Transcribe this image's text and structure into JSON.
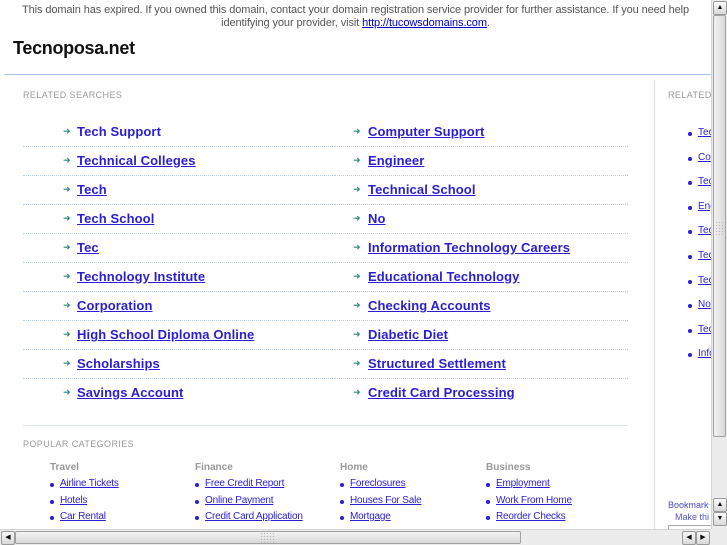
{
  "notice": {
    "text_before": "This domain has expired. If you owned this domain, contact your domain registration service provider for further assistance. If you need help identifying your provider, visit ",
    "link": "http://tucowsdomains.com",
    "text_after": "."
  },
  "site_title": "Tecnoposa.net",
  "related_searches": {
    "label": "RELATED SEARCHES",
    "left": [
      "Tech Support",
      "Technical Colleges",
      "Tech",
      "Tech School",
      "Tec",
      "Technology Institute",
      "Corporation",
      "High School Diploma Online",
      "Scholarships",
      "Savings Account"
    ],
    "right": [
      "Computer Support",
      "Engineer",
      "Technical School",
      "No",
      "Information Technology Careers",
      "Educational Technology",
      "Checking Accounts",
      "Diabetic Diet",
      "Structured Settlement",
      "Credit Card Processing"
    ]
  },
  "popular_categories": {
    "label": "POPULAR CATEGORIES",
    "categories": [
      {
        "title": "Travel",
        "links": [
          "Airline Tickets",
          "Hotels",
          "Car Rental"
        ]
      },
      {
        "title": "Finance",
        "links": [
          "Free Credit Report",
          "Online Payment",
          "Credit Card Application"
        ]
      },
      {
        "title": "Home",
        "links": [
          "Foreclosures",
          "Houses For Sale",
          "Mortgage"
        ]
      },
      {
        "title": "Business",
        "links": [
          "Employment",
          "Work From Home",
          "Reorder Checks"
        ]
      }
    ]
  },
  "sidebar": {
    "label": "RELATED",
    "items": [
      "Tec",
      "Co",
      "Tec",
      "Eng",
      "Tec",
      "Tec",
      "Tec",
      "No",
      "Tec",
      "Info"
    ],
    "bookmark": "Bookmark",
    "make_this": "Make thi"
  },
  "colors": {
    "link": "#2a1ed4",
    "arrow": "#2e8a7e",
    "rule": "#a9c3e6"
  }
}
